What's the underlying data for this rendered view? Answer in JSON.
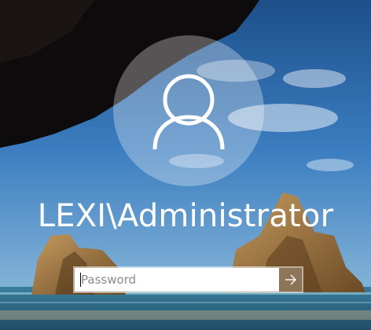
{
  "user": {
    "display_name": "LEXI\\Administrator",
    "avatar_icon": "user-icon"
  },
  "login": {
    "password_placeholder": "Password",
    "password_value": "",
    "submit_icon": "arrow-right-icon"
  },
  "colors": {
    "text": "#ffffff",
    "input_background": "#ffffff",
    "sky": "#2f6fb0"
  }
}
